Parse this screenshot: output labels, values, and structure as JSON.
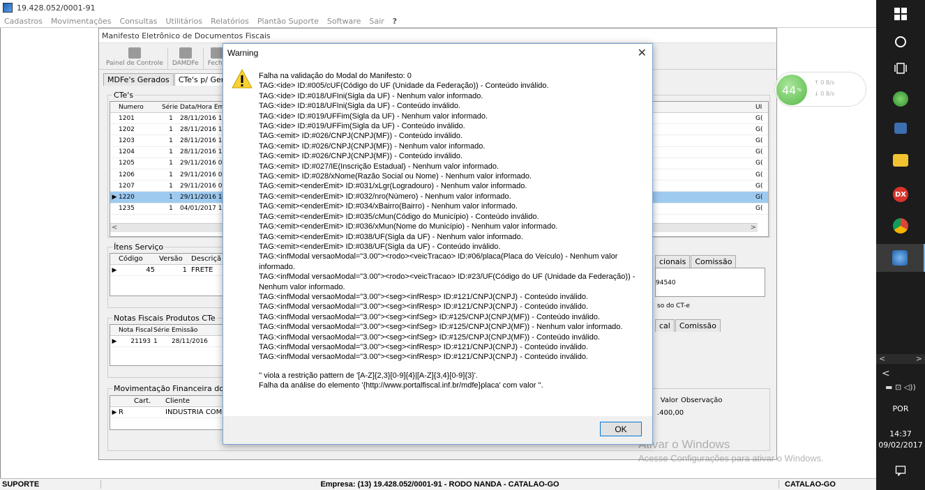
{
  "app": {
    "title": "19.428.052/0001-91",
    "menu": [
      "Cadastros",
      "Movimentações",
      "Consultas",
      "Utilitários",
      "Relatórios",
      "Plantão Suporte",
      "Software",
      "Sair"
    ]
  },
  "manifest_window": {
    "title": "Manifesto Eletrônico de Documentos Fiscais",
    "toolbar": [
      "Painel de Controle",
      "DAMDFe",
      "Fecha"
    ],
    "tabs": [
      "MDFe's Gerados",
      "CTe's p/ Gerar M"
    ],
    "ctes_group": "CTe's",
    "ctes_columns": [
      "Numero",
      "Série",
      "Data/Hora Em"
    ],
    "ctes_rows": [
      {
        "numero": "1201",
        "serie": "1",
        "data": "28/11/2016 18"
      },
      {
        "numero": "1202",
        "serie": "1",
        "data": "28/11/2016 18"
      },
      {
        "numero": "1203",
        "serie": "1",
        "data": "28/11/2016 18"
      },
      {
        "numero": "1204",
        "serie": "1",
        "data": "28/11/2016 18"
      },
      {
        "numero": "1205",
        "serie": "1",
        "data": "29/11/2016 06"
      },
      {
        "numero": "1206",
        "serie": "1",
        "data": "29/11/2016 07"
      },
      {
        "numero": "1207",
        "serie": "1",
        "data": "29/11/2016 07"
      },
      {
        "numero": "1220",
        "serie": "1",
        "data": "29/11/2016 14"
      },
      {
        "numero": "1235",
        "serie": "1",
        "data": "04/01/2017 15"
      }
    ],
    "ctes_right_col": "UI",
    "ctes_right_cells": [
      "G(",
      "G(",
      "G(",
      "G(",
      "G(",
      "G(",
      "G(",
      "G(",
      "G("
    ],
    "itens_group": "Ítens Serviço",
    "itens_columns": [
      "Código",
      "Versão",
      "Descriçã"
    ],
    "itens_row": {
      "codigo": "45",
      "versao": "1",
      "descricao": "FRETE"
    },
    "notas_group": "Notas Fiscais Produtos CTe",
    "notas_columns": [
      "Nota Fiscal",
      "Série",
      "Emissão"
    ],
    "notas_row": {
      "nota": "21193",
      "serie": "1",
      "emissao": "28/11/2016"
    },
    "mov_group": "Movimentação Financeira do CTe",
    "mov_columns": [
      "Cart.",
      "Cliente"
    ],
    "mov_row": {
      "cart": "R",
      "cliente": "INDUSTRIA COM"
    },
    "right_tabs1": [
      "cionais",
      "Comissão"
    ],
    "right_text1": "94540",
    "right_text2": "so do CT-e",
    "right_tabs2": [
      "cal",
      "Comissão"
    ],
    "right_mov_columns": [
      "Valor",
      "Observação"
    ],
    "right_mov_value": ".400,00"
  },
  "net_widget": {
    "percent": "44",
    "percent_sign": "%",
    "up": "0 B/s",
    "down": "0 B/s"
  },
  "warning_dialog": {
    "title": "Warning",
    "ok_label": "OK",
    "lines": [
      "Falha na validação do Modal do Manifesto: 0",
      "TAG:<ide> ID:#005/cUF(Código do UF (Unidade da Federação)) - Conteúdo inválido.",
      "TAG:<ide> ID:#018/UFIni(Sigla da UF) - Nenhum valor informado.",
      "TAG:<ide> ID:#018/UFIni(Sigla da UF) - Conteúdo inválido.",
      "TAG:<ide> ID:#019/UFFim(Sigla da UF) - Nenhum valor informado.",
      "TAG:<ide> ID:#019/UFFim(Sigla da UF) - Conteúdo inválido.",
      "TAG:<emit> ID:#026/CNPJ(CNPJ(MF)) - Conteúdo inválido.",
      "TAG:<emit> ID:#026/CNPJ(CNPJ(MF)) - Nenhum valor informado.",
      "TAG:<emit> ID:#026/CNPJ(CNPJ(MF)) - Conteúdo inválido.",
      "TAG:<emit> ID:#027/IE(Inscrição Estadual) - Nenhum valor informado.",
      "TAG:<emit> ID:#028/xNome(Razão Social ou Nome) - Nenhum valor informado.",
      "TAG:<emit><enderEmit> ID:#031/xLgr(Logradouro) - Nenhum valor informado.",
      "TAG:<emit><enderEmit> ID:#032/nro(Número) - Nenhum valor informado.",
      "TAG:<emit><enderEmit> ID:#034/xBairro(Bairro) - Nenhum valor informado.",
      "TAG:<emit><enderEmit> ID:#035/cMun(Código do Município) - Conteúdo inválido.",
      "TAG:<emit><enderEmit> ID:#036/xMun(Nome do Município) - Nenhum valor informado.",
      "TAG:<emit><enderEmit> ID:#038/UF(Sigla da UF) - Nenhum valor informado.",
      "TAG:<emit><enderEmit> ID:#038/UF(Sigla da UF) - Conteúdo inválido.",
      "TAG:<infModal versaoModal=\"3.00\"><rodo><veicTracao> ID:#06/placa(Placa do Veículo) - Nenhum valor informado.",
      "TAG:<infModal versaoModal=\"3.00\"><rodo><veicTracao> ID:#23/UF(Código do UF (Unidade da Federação)) - Nenhum valor informado.",
      "TAG:<infModal versaoModal=\"3.00\"><seg><infResp> ID:#121/CNPJ(CNPJ) - Conteúdo inválido.",
      "TAG:<infModal versaoModal=\"3.00\"><seg><infResp> ID:#121/CNPJ(CNPJ) - Conteúdo inválido.",
      "TAG:<infModal versaoModal=\"3.00\"><seg><infSeg> ID:#125/CNPJ(CNPJ(MF)) - Conteúdo inválido.",
      "TAG:<infModal versaoModal=\"3.00\"><seg><infSeg> ID:#125/CNPJ(CNPJ(MF)) - Nenhum valor informado.",
      "TAG:<infModal versaoModal=\"3.00\"><seg><infSeg> ID:#125/CNPJ(CNPJ(MF)) - Conteúdo inválido.",
      "TAG:<infModal versaoModal=\"3.00\"><seg><infResp> ID:#121/CNPJ(CNPJ) - Conteúdo inválido.",
      "TAG:<infModal versaoModal=\"3.00\"><seg><infResp> ID:#121/CNPJ(CNPJ) - Conteúdo inválido."
    ],
    "footer_lines": [
      "'' viola a restrição pattern de '[A-Z]{2,3}[0-9]{4}|[A-Z]{3,4}[0-9]{3}'.",
      "Falha da análise do elemento '{http://www.portalfiscal.inf.br/mdfe}placa' com valor ''."
    ]
  },
  "watermark": {
    "line1": "Ativar o Windows",
    "line2": "Acesse Configurações para ativar o Windows."
  },
  "statusbar": {
    "left": "SUPORTE",
    "center": "Empresa: (13) 19.428.052/0001-91 - RODO NANDA - CATALAO-GO",
    "right": "CATALAO-GO"
  },
  "taskbar": {
    "lang": "POR",
    "time": "14:37",
    "date": "09/02/2017",
    "colors": {
      "bg": "#1c1c1c",
      "dx": "#d9342b",
      "chrome": "#f4b400",
      "files": "#f2c230"
    }
  }
}
